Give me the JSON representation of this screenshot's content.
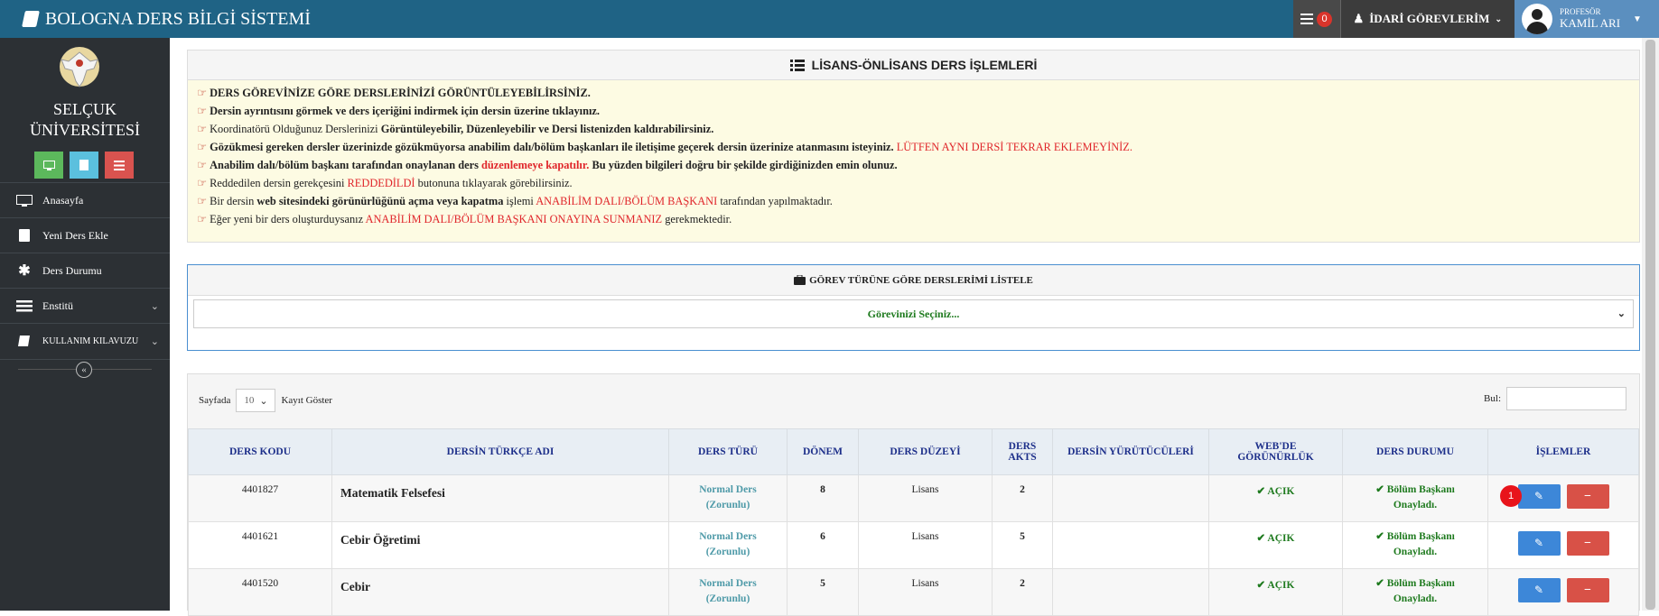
{
  "app": {
    "title": "BOLOGNA DERS BİLGİ SİSTEMİ"
  },
  "topbar": {
    "notif_count": "0",
    "duties_label": "İDARİ GÖREVLERİM",
    "profile_role": "PROFESÖR",
    "profile_name": "KAMİL ARI"
  },
  "sidebar": {
    "uni_line1": "SELÇUK",
    "uni_line2": "ÜNİVERSİTESİ",
    "items": [
      {
        "label": "Anasayfa",
        "icon": "monitor-icon"
      },
      {
        "label": "Yeni Ders Ekle",
        "icon": "book-icon"
      },
      {
        "label": "Ders Durumu",
        "icon": "asterisk-icon"
      },
      {
        "label": "Enstitü",
        "icon": "list-icon"
      },
      {
        "label": "KULLANIM KILAVUZU",
        "icon": "book-open-icon"
      }
    ]
  },
  "info_panel": {
    "title": "LİSANS-ÖNLİSANS DERS İŞLEMLERİ",
    "lines": {
      "l1": "DERS GÖREVİNİZE GÖRE DERSLERİNİZİ GÖRÜNTÜLEYEBİLİRSİNİZ.",
      "l2": "Dersin ayrıntısını görmek ve ders içeriğini indirmek için dersin üzerine tıklayınız.",
      "l3a": "Koordinatörü Olduğunuz Derslerinizi ",
      "l3b": "Görüntüleyebilir, Düzenleyebilir ve Dersi listenizden kaldırabilirsiniz.",
      "l4a": "Gözükmesi gereken dersler üzerinizde gözükmüyorsa anabilim dalı/bölüm başkanları ile iletişime geçerek dersin üzerinize atanmasını isteyiniz. ",
      "l4b": "LÜTFEN AYNI DERSİ TEKRAR EKLEMEYİNİZ.",
      "l5a": "Anabilim dalı/bölüm başkanı tarafından onaylanan ders ",
      "l5b": "düzenlemeye kapatılır.",
      "l5c": " Bu yüzden bilgileri doğru bir şekilde girdiğinizden emin olunuz.",
      "l6a": "Reddedilen dersin gerekçesini ",
      "l6b": "REDDEDİLDİ",
      "l6c": " butonuna tıklayarak görebilirsiniz.",
      "l7a": "Bir dersin ",
      "l7b": "web sitesindeki görünürlüğünü açma veya kapatma",
      "l7c": " işlemi ",
      "l7d": "ANABİLİM DALI/BÖLÜM BAŞKANI",
      "l7e": " tarafından yapılmaktadır.",
      "l8a": "Eğer yeni bir ders oluşturduysanız ",
      "l8b": "ANABİLİM DALI/BÖLÜM BAŞKANI ONAYINA SUNMANIZ",
      "l8c": " gerekmektedir."
    }
  },
  "filter_panel": {
    "title": "GÖREV TÜRÜNE GÖRE DERSLERİMİ LİSTELE",
    "select_value": "Görevinizi Seçiniz..."
  },
  "table_panel": {
    "page_label": "Sayfada",
    "page_size": "10",
    "show_label": "Kayıt Göster",
    "search_label": "Bul:",
    "headers": {
      "code": "DERS KODU",
      "name": "DERSİN TÜRKÇE ADI",
      "type": "DERS TÜRÜ",
      "term": "DÖNEM",
      "level": "DERS DÜZEYİ",
      "akts1": "DERS",
      "akts2": "AKTS",
      "lecturers": "DERSİN YÜRÜTÜCÜLERİ",
      "web1": "WEB'DE",
      "web2": "GÖRÜNÜRLÜK",
      "status": "DERS DURUMU",
      "ops": "İŞLEMLER"
    },
    "rows": [
      {
        "code": "4401827",
        "name": "Matematik Felsefesi",
        "type1": "Normal Ders",
        "type2": "(Zorunlu)",
        "term": "8",
        "level": "Lisans",
        "akts": "2",
        "lecturers": "",
        "web": "AÇIK",
        "status1": "Bölüm Başkanı",
        "status2": "Onayladı."
      },
      {
        "code": "4401621",
        "name": "Cebir Öğretimi",
        "type1": "Normal Ders",
        "type2": "(Zorunlu)",
        "term": "6",
        "level": "Lisans",
        "akts": "5",
        "lecturers": "",
        "web": "AÇIK",
        "status1": "Bölüm Başkanı",
        "status2": "Onayladı."
      },
      {
        "code": "4401520",
        "name": "Cebir",
        "type1": "Normal Ders",
        "type2": "(Zorunlu)",
        "term": "5",
        "level": "Lisans",
        "akts": "2",
        "lecturers": "",
        "web": "AÇIK",
        "status1": "Bölüm Başkanı",
        "status2": "Onayladı."
      }
    ],
    "marker_label": "1"
  },
  "colors": {
    "topbar": "#1f6385",
    "sidebar": "#2c3034",
    "edit": "#3d87d8",
    "delete": "#d85147",
    "alert": "#e0262b"
  }
}
